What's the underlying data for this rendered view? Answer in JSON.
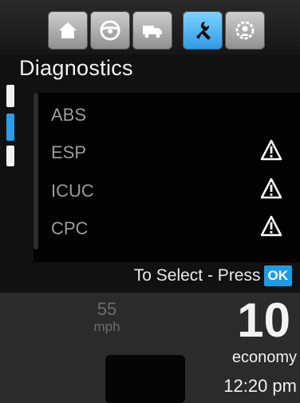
{
  "tabs": [
    {
      "icon": "home-icon",
      "active": false
    },
    {
      "icon": "steering-wheel-icon",
      "active": false
    },
    {
      "icon": "truck-icon",
      "active": false
    },
    {
      "icon": "wrench-icon",
      "active": true
    },
    {
      "icon": "settings-gear-icon",
      "active": false
    }
  ],
  "header": {
    "title": "Diagnostics"
  },
  "list": {
    "items": [
      {
        "label": "ABS",
        "warning": false
      },
      {
        "label": "ESP",
        "warning": true
      },
      {
        "label": "ICUC",
        "warning": true
      },
      {
        "label": "CPC",
        "warning": true
      }
    ]
  },
  "hint": {
    "text": "To Select - Press",
    "ok_label": "OK"
  },
  "cluster": {
    "speed_value": "55",
    "speed_unit": "mph",
    "economy_value": "10",
    "economy_label": "economy",
    "time": "12:20 pm"
  },
  "colors": {
    "accent": "#1e9be5",
    "active_tab": "#4fb6f2",
    "inactive_tab": "#b3b3b3",
    "list_text": "#9c9c9c"
  }
}
